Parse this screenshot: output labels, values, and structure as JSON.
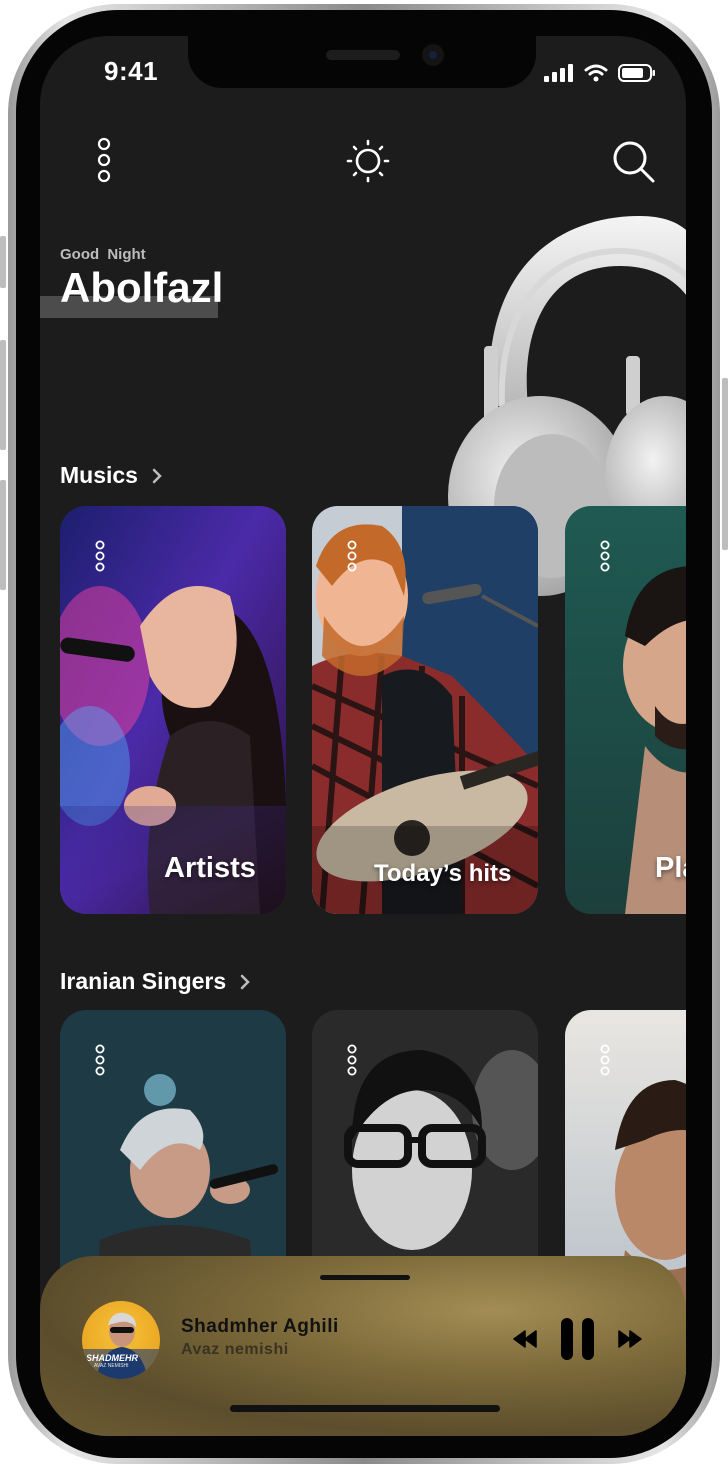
{
  "status_bar": {
    "time": "9:41"
  },
  "header": {
    "menu_icon": "vertical-dots-icon",
    "theme_icon": "sun-icon",
    "search_icon": "search-icon"
  },
  "greeting": {
    "subtitle": "Good Night",
    "name": "Abolfazl"
  },
  "sections": [
    {
      "title": "Musics",
      "cards": [
        {
          "label": "Artists"
        },
        {
          "label": "Today’s hits"
        },
        {
          "label": "Pla"
        }
      ]
    },
    {
      "title": "Iranian Singers",
      "cards": [
        {},
        {},
        {}
      ]
    }
  ],
  "now_playing": {
    "title": "Shadmher Aghili",
    "artist": "Avaz nemishi",
    "album_art_text": "SHADMEHR",
    "album_art_subtext": "AVAZ NEMISHI",
    "state": "playing"
  },
  "colors": {
    "background": "#1c1c1c",
    "player": "#7d6a3a",
    "text": "#ffffff"
  }
}
